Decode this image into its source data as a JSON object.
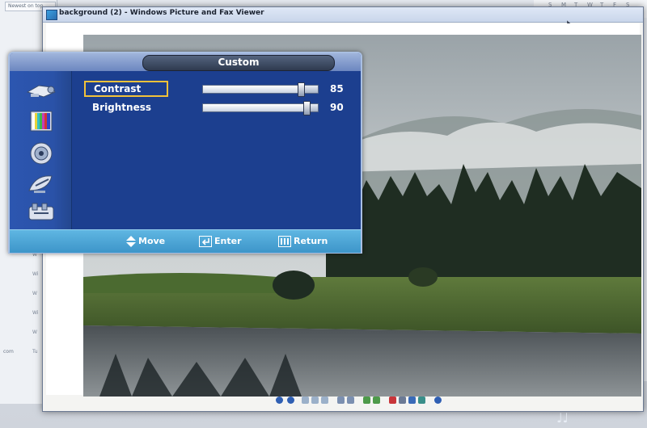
{
  "desktop": {
    "left_panel": {
      "sort_label": "Newest on top",
      "rows": [
        "W",
        "Wi",
        "W",
        "Wi",
        "W",
        "Tu"
      ],
      "email": "com"
    },
    "calendar_header": [
      "S",
      "M",
      "T",
      "W",
      "T",
      "F",
      "S"
    ]
  },
  "viewer": {
    "title": "background (2) - Windows Picture and Fax Viewer",
    "icons": [
      "app-icon",
      "mouse-cursor-icon"
    ]
  },
  "osd": {
    "title": "Custom",
    "sidebar_icons": [
      "picture-icon",
      "color-bars-icon",
      "sound-icon",
      "antenna-icon",
      "setup-icon"
    ],
    "settings": [
      {
        "label": "Contrast",
        "value": "85",
        "level": 85,
        "selected": true
      },
      {
        "label": "Brightness",
        "value": "90",
        "level": 90,
        "selected": false
      }
    ],
    "footer": {
      "move_label": "Move",
      "enter_label": "Enter",
      "return_label": "Return"
    }
  },
  "colors": {
    "osd_body": "#1c3f8f",
    "osd_footer": "#3d95c9",
    "selection_border": "#f2c23a"
  }
}
